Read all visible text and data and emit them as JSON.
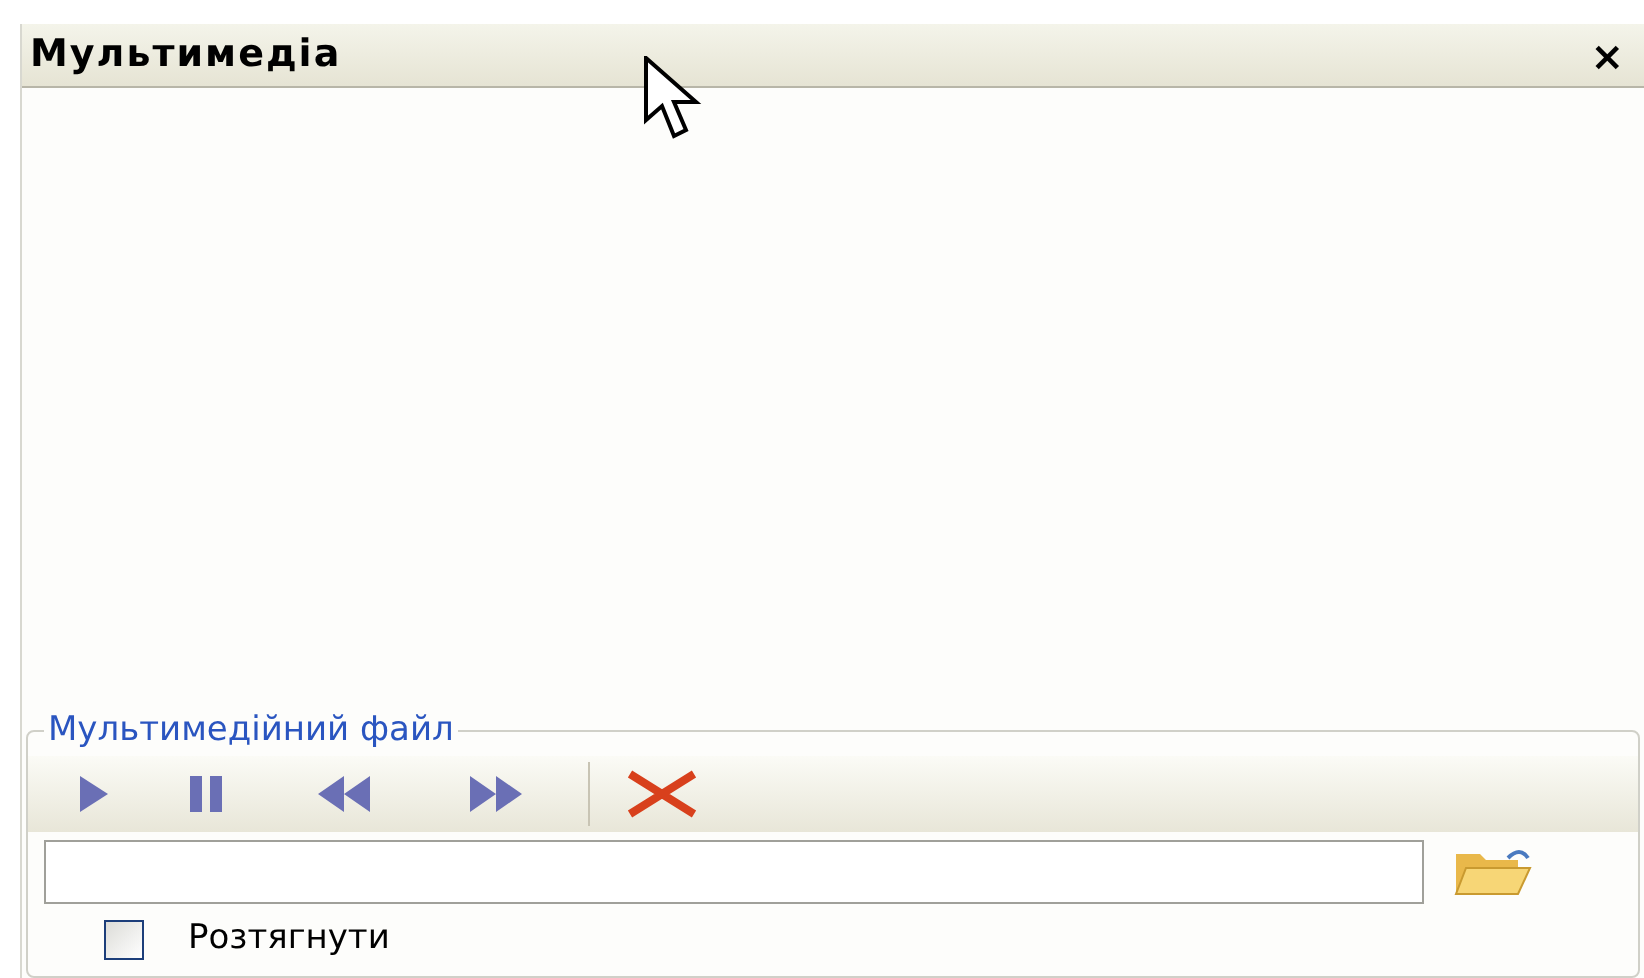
{
  "panel": {
    "title": "Мультимедіа",
    "close": "×"
  },
  "media_group": {
    "label": "Мультимедійний файл",
    "toolbar": [
      {
        "kind": "play"
      },
      {
        "kind": "pause"
      },
      {
        "kind": "rewind"
      },
      {
        "kind": "forward"
      },
      {
        "kind": "separator"
      },
      {
        "kind": "delete"
      }
    ],
    "file_field": {
      "kind": "text"
    },
    "stretch": {
      "label": "Розтягнути",
      "checked": false
    }
  }
}
